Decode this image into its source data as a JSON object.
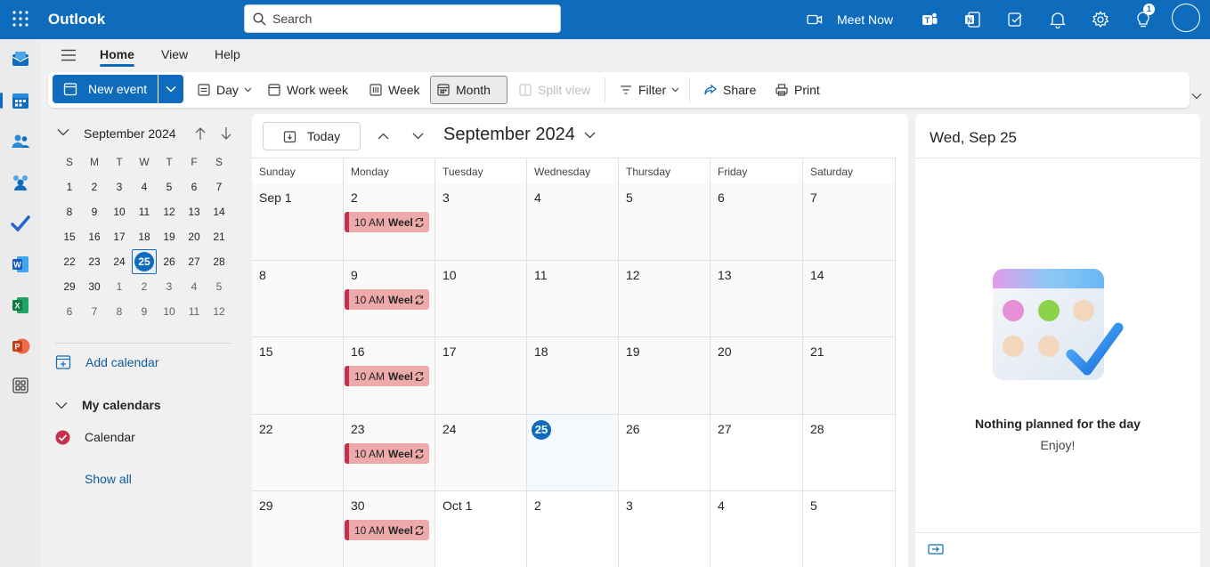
{
  "app": {
    "title": "Outlook"
  },
  "search": {
    "placeholder": "Search"
  },
  "topbar": {
    "meet_now_label": "Meet Now",
    "notification_count": "1"
  },
  "nav": {
    "tabs": [
      "Home",
      "View",
      "Help"
    ],
    "active_tab": "Home"
  },
  "ribbon": {
    "new_event": "New event",
    "day": "Day",
    "work_week": "Work week",
    "week": "Week",
    "month": "Month",
    "split_view": "Split view",
    "filter": "Filter",
    "share": "Share",
    "print": "Print"
  },
  "mini_calendar": {
    "month_label": "September 2024",
    "weekdays": [
      "S",
      "M",
      "T",
      "W",
      "T",
      "F",
      "S"
    ],
    "weeks": [
      [
        "1",
        "2",
        "3",
        "4",
        "5",
        "6",
        "7"
      ],
      [
        "8",
        "9",
        "10",
        "11",
        "12",
        "13",
        "14"
      ],
      [
        "15",
        "16",
        "17",
        "18",
        "19",
        "20",
        "21"
      ],
      [
        "22",
        "23",
        "24",
        "25",
        "26",
        "27",
        "28"
      ],
      [
        "29",
        "30",
        "1",
        "2",
        "3",
        "4",
        "5"
      ],
      [
        "6",
        "7",
        "8",
        "9",
        "10",
        "11",
        "12"
      ]
    ],
    "today": "25"
  },
  "sidebar": {
    "add_calendar": "Add calendar",
    "my_calendars": "My calendars",
    "calendar_name": "Calendar",
    "show_all": "Show all",
    "calendar_color": "#c4314b"
  },
  "main": {
    "today_button": "Today",
    "month_title": "September 2024",
    "weekdays": [
      "Sunday",
      "Monday",
      "Tuesday",
      "Wednesday",
      "Thursday",
      "Friday",
      "Saturday"
    ],
    "weeks": [
      [
        "Sep 1",
        "2",
        "3",
        "4",
        "5",
        "6",
        "7"
      ],
      [
        "8",
        "9",
        "10",
        "11",
        "12",
        "13",
        "14"
      ],
      [
        "15",
        "16",
        "17",
        "18",
        "19",
        "20",
        "21"
      ],
      [
        "22",
        "23",
        "24",
        "25",
        "26",
        "27",
        "28"
      ],
      [
        "29",
        "30",
        "Oct 1",
        "2",
        "3",
        "4",
        "5"
      ]
    ],
    "today_cell": "25",
    "event": {
      "time": "10 AM",
      "title": "Weel",
      "recurring": true,
      "color": "#c4314b",
      "fill": "#eeaaab"
    }
  },
  "agenda": {
    "date": "Wed, Sep 25",
    "empty_title": "Nothing planned for the day",
    "empty_subtitle": "Enjoy!"
  },
  "colors": {
    "brand": "#0f6cbd",
    "event_accent": "#c4314b"
  }
}
